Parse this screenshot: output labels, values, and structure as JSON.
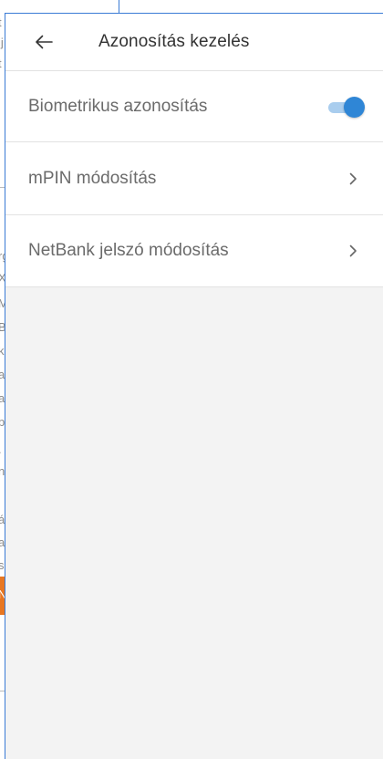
{
  "header": {
    "title": "Azonosítás kezelés",
    "back_icon": "arrow-left-icon"
  },
  "settings": {
    "items": [
      {
        "label": "Biometrikus azonosítás",
        "control": "toggle",
        "enabled": true
      },
      {
        "label": "mPIN módosítás",
        "control": "chevron-right-icon"
      },
      {
        "label": "NetBank jelszó módosítás",
        "control": "chevron-right-icon"
      }
    ]
  },
  "colors": {
    "accent": "#2f86d6",
    "toggle_track": "#a9cdee",
    "panel_border": "#3a7bd5",
    "background": "#f3f3f3",
    "behind_orange": "#e87722"
  },
  "behind_page": {
    "fragments": [
      "t",
      "jj",
      "t",
      "rg",
      "X",
      "M",
      "B",
      "k",
      "a",
      "a",
      "b",
      ".",
      "n",
      "á",
      "a",
      "s",
      "N"
    ]
  }
}
